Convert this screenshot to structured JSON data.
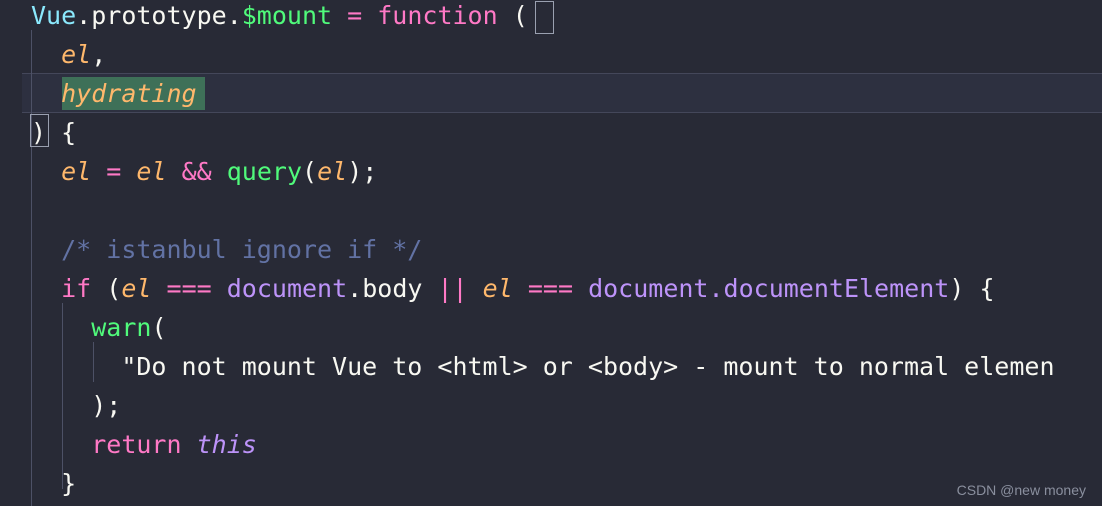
{
  "editor": {
    "theme_name": "dracula-dark",
    "background_color": "#282a36",
    "current_line_color": "#2d3040",
    "selection_color": "#3e7058",
    "indent_guide_color": "#4d5166",
    "bracket_match_border": "#9aa0b0",
    "font_size_px": 25,
    "line_height_px": 39
  },
  "colors": {
    "class": "#8be9fd",
    "plain": "#f8f8f2",
    "property": "#50fa7b",
    "operator": "#ff79c6",
    "keyword": "#ff79c6",
    "parameter": "#ffb86c",
    "comment": "#6272a4",
    "string": "#f1fa8c",
    "object": "#bd93f9"
  },
  "code": {
    "line1": {
      "vue": "Vue",
      "dot1": ".",
      "prototype": "prototype",
      "dot2": ".",
      "mount": "$mount",
      "space1": " ",
      "equals": "=",
      "space2": " ",
      "function_kw": "function",
      "space3": " ",
      "open_paren": "("
    },
    "line2": {
      "indent": "  ",
      "el": "el",
      "comma": ","
    },
    "line3": {
      "indent": "  ",
      "hydrating": "hydrating"
    },
    "line4": {
      "close_paren": ")",
      "space": " ",
      "open_brace": "{"
    },
    "line5": {
      "indent": "  ",
      "el1": "el",
      "sp1": " ",
      "assign": "=",
      "sp2": " ",
      "el2": "el",
      "sp3": " ",
      "and": "&&",
      "sp4": " ",
      "query": "query",
      "lparen": "(",
      "el3": "el",
      "rparen": ")",
      "semi": ";"
    },
    "line6": {
      "text": ""
    },
    "line7": {
      "indent": "  ",
      "comment": "/* istanbul ignore if */"
    },
    "line8": {
      "indent": "  ",
      "if_kw": "if",
      "sp1": " ",
      "lparen": "(",
      "el1": "el",
      "sp2": " ",
      "eq1": "===",
      "sp3": " ",
      "document1": "document",
      "dot1": ".",
      "body": "body",
      "sp4": " ",
      "or": "||",
      "sp5": " ",
      "el2": "el",
      "sp6": " ",
      "eq2": "===",
      "sp7": " ",
      "document2": "document",
      "dot2": ".",
      "documentElement": "documentElement",
      "rparen": ")",
      "sp8": " ",
      "lbrace": "{"
    },
    "line9": {
      "indent": "    ",
      "warn": "warn",
      "lparen": "("
    },
    "line10": {
      "indent": "      ",
      "string": "\"Do not mount Vue to <html> or <body> - mount to normal elemen"
    },
    "line11": {
      "indent": "    ",
      "rparen": ")",
      "semi": ";"
    },
    "line12": {
      "indent": "    ",
      "return_kw": "return",
      "sp": " ",
      "this_kw": "this"
    },
    "line13": {
      "indent": "  ",
      "rbrace": "}"
    }
  },
  "watermark": {
    "text": "CSDN @new money"
  }
}
